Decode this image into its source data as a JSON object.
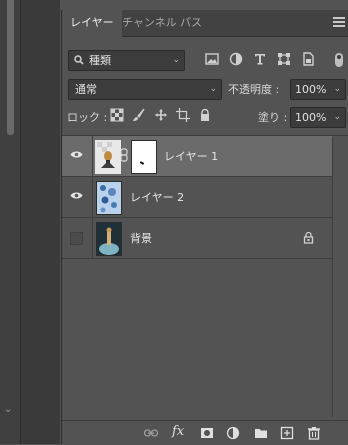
{
  "tabs": [
    {
      "label": "レイヤー",
      "active": true
    },
    {
      "label": "チャンネル",
      "active": false
    },
    {
      "label": "パス",
      "active": false
    }
  ],
  "filter": {
    "kind_label": "種類",
    "icons": [
      "image-filter-icon",
      "adjustment-filter-icon",
      "type-filter-icon",
      "shape-filter-icon",
      "smart-object-filter-icon"
    ]
  },
  "blend_mode": "通常",
  "opacity": {
    "label": "不透明度 :",
    "value": "100%"
  },
  "lock": {
    "label": "ロック :",
    "icons": [
      "lock-transparent-icon",
      "lock-image-icon",
      "lock-position-icon",
      "lock-artboard-icon",
      "lock-all-icon"
    ]
  },
  "fill": {
    "label": "塗り :",
    "value": "100%"
  },
  "layers": [
    {
      "name": "レイヤー 1",
      "visible": true,
      "selected": true,
      "has_mask": true,
      "locked": false
    },
    {
      "name": "レイヤー 2",
      "visible": true,
      "selected": false,
      "has_mask": false,
      "locked": false
    },
    {
      "name": "背景",
      "visible": false,
      "selected": false,
      "has_mask": false,
      "locked": true
    }
  ],
  "bottom_icons": [
    "link-layers-icon",
    "fx-icon",
    "add-mask-icon",
    "adjustment-layer-icon",
    "new-group-icon",
    "new-layer-icon",
    "delete-layer-icon"
  ],
  "bottom_fx_label": "fx",
  "colors": {
    "panel": "#535353",
    "selected_layer": "#6b6b6b",
    "field": "#3c3c3c",
    "tabbar": "#424242"
  }
}
